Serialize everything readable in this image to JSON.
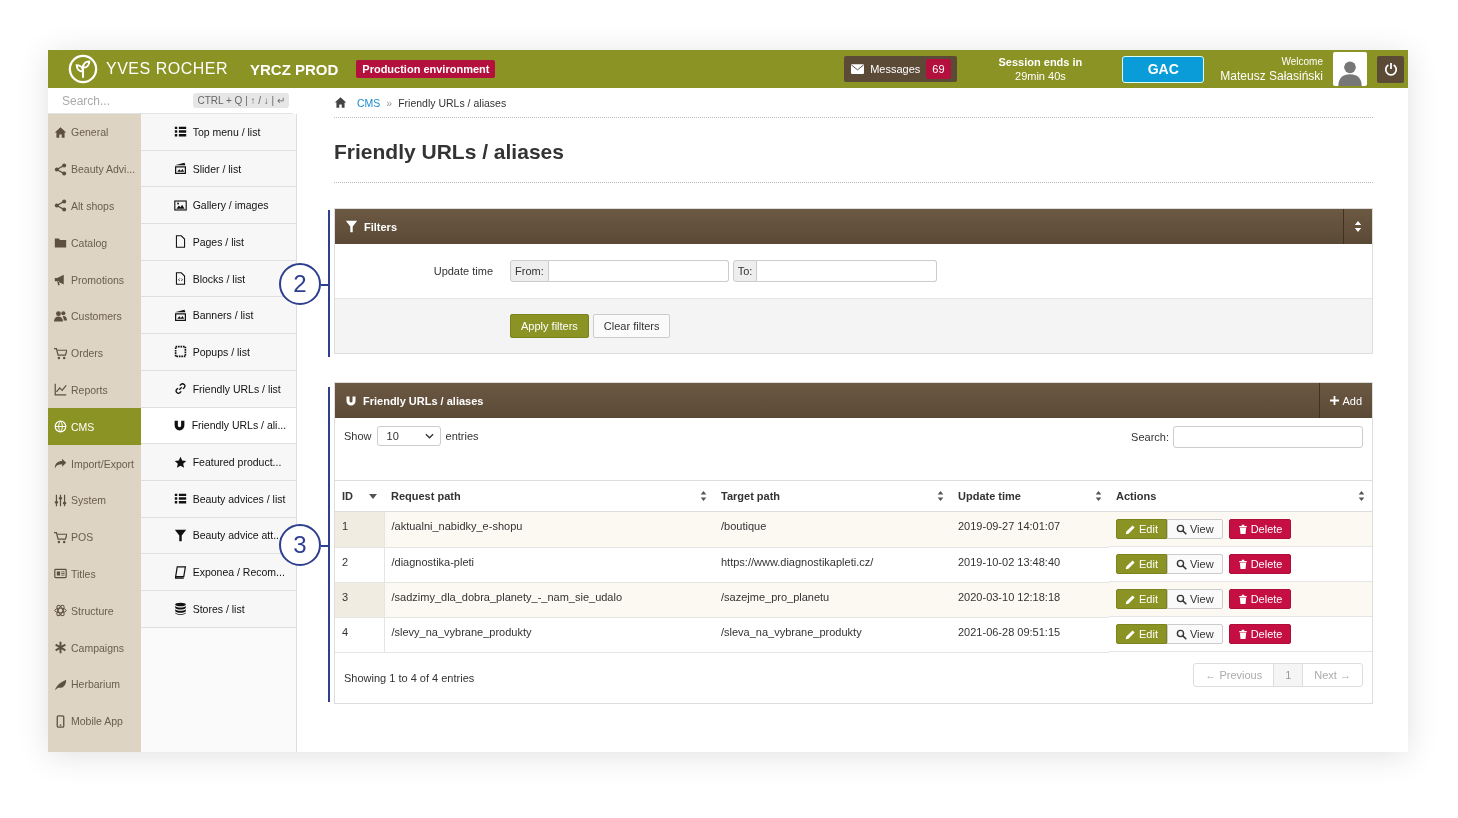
{
  "header": {
    "brand": "YVES ROCHER",
    "instance": "YRCZ PROD",
    "environment": "Production environment",
    "messages": {
      "label": "Messages",
      "count": "69"
    },
    "session": {
      "label": "Session ends in",
      "remaining": "29min 40s"
    },
    "gac_button": "GAC",
    "welcome": "Welcome",
    "user": "Mateusz Sałasiński"
  },
  "search": {
    "placeholder": "Search...",
    "shortcut": "CTRL + Q | ↑ / ↓ | ↵"
  },
  "sidebar": {
    "items": [
      {
        "label": "General",
        "selected": false
      },
      {
        "label": "Beauty Advi...",
        "selected": false
      },
      {
        "label": "Alt shops",
        "selected": false
      },
      {
        "label": "Catalog",
        "selected": false
      },
      {
        "label": "Promotions",
        "selected": false
      },
      {
        "label": "Customers",
        "selected": false
      },
      {
        "label": "Orders",
        "selected": false
      },
      {
        "label": "Reports",
        "selected": false
      },
      {
        "label": "CMS",
        "selected": true
      },
      {
        "label": "Import/Export",
        "selected": false
      },
      {
        "label": "System",
        "selected": false
      },
      {
        "label": "POS",
        "selected": false
      },
      {
        "label": "Titles",
        "selected": false
      },
      {
        "label": "Structure",
        "selected": false
      },
      {
        "label": "Campaigns",
        "selected": false
      },
      {
        "label": "Herbarium",
        "selected": false
      },
      {
        "label": "Mobile App",
        "selected": false
      }
    ]
  },
  "submenu": {
    "items": [
      {
        "label": "Top menu / list",
        "selected": false
      },
      {
        "label": "Slider / list",
        "selected": false
      },
      {
        "label": "Gallery / images",
        "selected": false
      },
      {
        "label": "Pages / list",
        "selected": false
      },
      {
        "label": "Blocks / list",
        "selected": false
      },
      {
        "label": "Banners / list",
        "selected": false
      },
      {
        "label": "Popups / list",
        "selected": false
      },
      {
        "label": "Friendly URLs / list",
        "selected": false
      },
      {
        "label": "Friendly URLs / ali...",
        "selected": true
      },
      {
        "label": "Featured product...",
        "selected": false
      },
      {
        "label": "Beauty advices / list",
        "selected": false
      },
      {
        "label": "Beauty advice att...",
        "selected": false
      },
      {
        "label": "Exponea / Recom...",
        "selected": false
      },
      {
        "label": "Stores / list",
        "selected": false
      }
    ]
  },
  "breadcrumb": {
    "link": "CMS",
    "separator": "»",
    "current": "Friendly URLs / aliases"
  },
  "title": "Friendly URLs / aliases",
  "filters": {
    "title": "Filters",
    "field_label": "Update time",
    "from_label": "From:",
    "to_label": "To:",
    "apply": "Apply filters",
    "clear": "Clear filters"
  },
  "table_panel": {
    "title": "Friendly URLs / aliases",
    "add": "Add",
    "show_label": "Show",
    "page_size": "10",
    "entries_label": "entries",
    "search_label": "Search:",
    "columns": [
      {
        "label": "ID",
        "sorted": true
      },
      {
        "label": "Request path",
        "sorted": false
      },
      {
        "label": "Target path",
        "sorted": false
      },
      {
        "label": "Update time",
        "sorted": false
      },
      {
        "label": "Actions",
        "sorted": false
      }
    ],
    "rows": [
      {
        "id": "1",
        "request": "/aktualni_nabidky_e-shopu",
        "target": "/boutique",
        "updated": "2019-09-27 14:01:07",
        "actions": [
          "Edit",
          "View",
          "Delete"
        ]
      },
      {
        "id": "2",
        "request": "/diagnostika-pleti",
        "target": "https://www.diagnostikapleti.cz/",
        "updated": "2019-10-02 13:48:40",
        "actions": [
          "Edit",
          "View",
          "Delete"
        ]
      },
      {
        "id": "3",
        "request": "/sadzimy_dla_dobra_planety_-_nam_sie_udalo",
        "target": "/sazejme_pro_planetu",
        "updated": "2020-03-10 12:18:18",
        "actions": [
          "Edit",
          "View",
          "Delete"
        ]
      },
      {
        "id": "4",
        "request": "/slevy_na_vybrane_produkty",
        "target": "/sleva_na_vybrane_produkty",
        "updated": "2021-06-28 09:51:15",
        "actions": [
          "Edit",
          "View",
          "Delete"
        ]
      }
    ],
    "info": "Showing 1 to 4 of 4 entries",
    "pagination": [
      {
        "label": "← Previous",
        "disabled": true,
        "selected": false
      },
      {
        "label": "1",
        "disabled": false,
        "selected": true
      },
      {
        "label": "Next →",
        "disabled": true,
        "selected": false
      }
    ]
  },
  "annotations": [
    {
      "label": "2"
    },
    {
      "label": "3"
    }
  ]
}
